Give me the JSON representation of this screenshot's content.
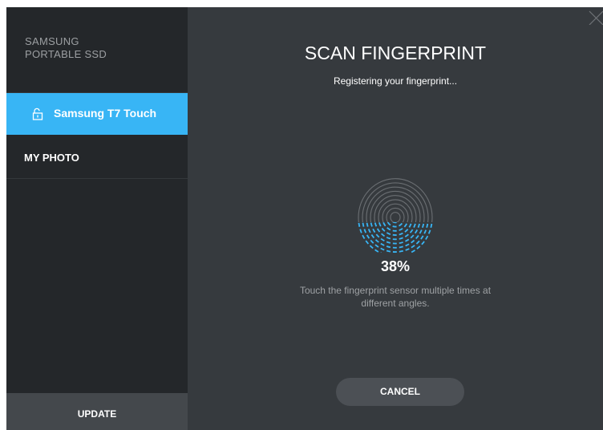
{
  "sidebar": {
    "brand_line1": "SAMSUNG",
    "brand_line2": "PORTABLE SSD",
    "device": {
      "label": "Samsung T7 Touch",
      "icon": "lock-open-icon"
    },
    "folder": {
      "label": "MY PHOTO"
    },
    "update_label": "UPDATE"
  },
  "main": {
    "title": "SCAN FINGERPRINT",
    "subtitle": "Registering your fingerprint...",
    "progress_text": "38%",
    "progress_value": 0.38,
    "instruction_line1": "Touch the fingerprint sensor multiple times at",
    "instruction_line2": "different angles.",
    "cancel_label": "CANCEL"
  },
  "colors": {
    "accent": "#38b5f5",
    "sidebar_bg": "#24272a",
    "main_bg": "#363a3e",
    "button_bg": "#4c5055",
    "fingerprint_inactive": "#6b6f73"
  }
}
